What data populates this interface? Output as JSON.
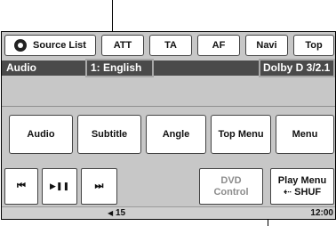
{
  "top_buttons": {
    "source_list": "Source List",
    "att": "ATT",
    "ta": "TA",
    "af": "AF",
    "navi": "Navi",
    "top": "Top"
  },
  "info_bar": {
    "mode_label": "Audio",
    "audio_track": "1: English",
    "audio_format": "Dolby D 3/2.1"
  },
  "menu_buttons": {
    "audio": "Audio",
    "subtitle": "Subtitle",
    "angle": "Angle",
    "top_menu": "Top Menu",
    "menu": "Menu"
  },
  "controls": {
    "prev_icon": "⏮",
    "play_pause_icon": "▶❚❚",
    "next_icon": "⏭",
    "dvd_control_line1": "DVD",
    "dvd_control_line2": "Control",
    "play_menu_line1": "Play Menu",
    "play_menu_line2": "⇠ SHUF"
  },
  "status_bar": {
    "volume_icon": "◀",
    "volume": "15",
    "clock": "12:00"
  }
}
